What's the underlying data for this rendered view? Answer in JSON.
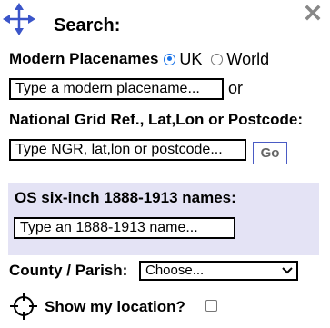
{
  "header": {
    "title": "Search:",
    "move_icon": "four-way-arrow-icon",
    "close_icon": "close-x-icon"
  },
  "modern": {
    "label": "Modern Placenames",
    "options": [
      {
        "label": "UK",
        "checked": true
      },
      {
        "label": "World",
        "checked": false
      }
    ],
    "placeholder": "Type a modern placename...",
    "value": "",
    "or_text": "or"
  },
  "ngr": {
    "label": "National Grid Ref., Lat,Lon or Postcode:",
    "placeholder": "Type NGR, lat,lon or postcode...",
    "value": "",
    "go_label": "Go"
  },
  "os": {
    "label": "OS six-inch 1888-1913 names:",
    "placeholder": "Type an 1888-1913 name...",
    "value": "",
    "panel_color": "#e4e3f5"
  },
  "county": {
    "label": "County / Parish:",
    "selected": "Choose..."
  },
  "location": {
    "label": "Show my location?",
    "checked": false,
    "icon": "crosshair-location-icon"
  },
  "colors": {
    "accent_blue": "#1a73e8",
    "icon_blue": "#3b55c9",
    "go_border": "#4a5bc4",
    "close_gray": "#888888"
  }
}
